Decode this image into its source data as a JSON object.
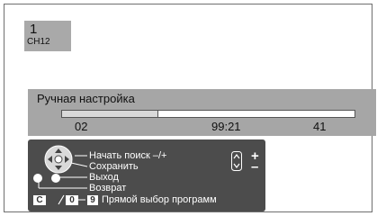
{
  "channel": {
    "number": "1",
    "name": "CH12"
  },
  "tuning": {
    "title": "Ручная настройка",
    "progress": 0.33,
    "left_value": "02",
    "mid_value": "99:21",
    "right_value": "41"
  },
  "help": {
    "start_search": "Начать поиск –/+",
    "save": "Сохранить",
    "exit": "Выход",
    "back": "Возврат",
    "key_c": "C",
    "key_slash": "/",
    "key_0": "0",
    "key_9": "9",
    "direct_select": "Прямой выбор программ",
    "plus": "+",
    "minus": "–"
  },
  "icons": {
    "dpad": "dpad-icon",
    "up_down": "up-down-icon",
    "red_button": "red-dot-icon",
    "blue_button": "blue-dot-icon"
  },
  "colors": {
    "panel_dark": "#4c4c4c",
    "panel_grey": "#a6a6a6",
    "badge_grey": "#a9a9a9"
  }
}
